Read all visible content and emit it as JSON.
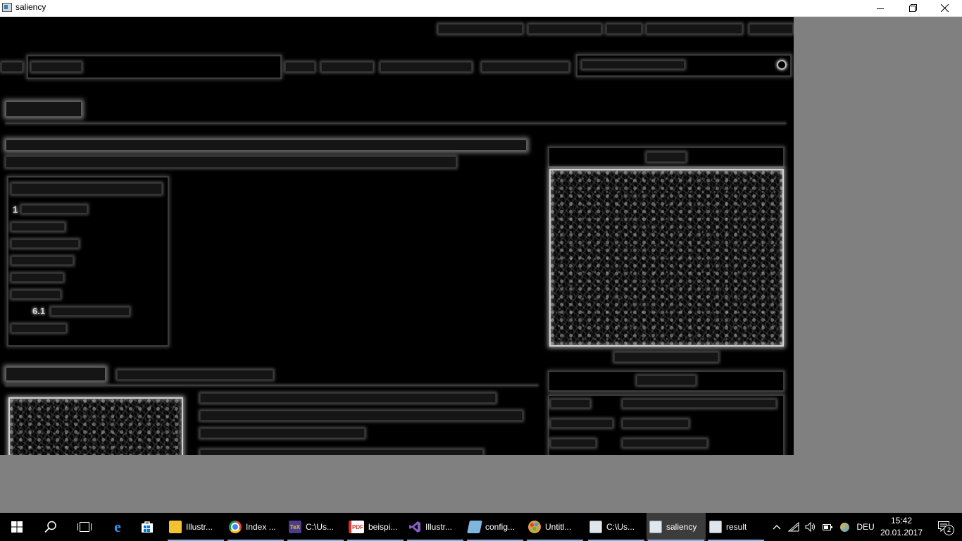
{
  "window": {
    "title": "saliency",
    "controls": {
      "minimize": "minimize-icon",
      "maximize": "restore-icon",
      "close": "close-icon"
    }
  },
  "content": {
    "description_type": "saliency-map",
    "background": "#000000",
    "outer_background": "#808080",
    "toc_numbers": [
      "1",
      "6.1"
    ]
  },
  "taskbar": {
    "start": "windows-start-icon",
    "search": "search-icon",
    "task_view": "task-view-icon",
    "pinned": [
      "edge-icon",
      "store-icon"
    ],
    "tasks": [
      {
        "label": "Illustr...",
        "icon": "folder-icon",
        "color": "#f2c230"
      },
      {
        "label": "Index ...",
        "icon": "chrome-icon",
        "color": "#db4437"
      },
      {
        "label": "C:\\Us...",
        "icon": "texstudio-icon",
        "color": "#4b3c8c"
      },
      {
        "label": "beispi...",
        "icon": "pdf-icon",
        "color": "#d9302c"
      },
      {
        "label": "Illustr...",
        "icon": "visual-studio-icon",
        "color": "#865fc5"
      },
      {
        "label": "config...",
        "icon": "notepad-icon",
        "color": "#7fb6e0"
      },
      {
        "label": "Untitl...",
        "icon": "paint-icon",
        "color": "#d4a04a"
      },
      {
        "label": "C:\\Us...",
        "icon": "app-window-icon",
        "color": "#8ca0b0"
      },
      {
        "label": "saliency",
        "icon": "app-window-icon",
        "color": "#8ca0b0"
      },
      {
        "label": "result",
        "icon": "app-window-icon",
        "color": "#8ca0b0"
      }
    ],
    "tray": {
      "language": "DEU",
      "time": "15:42",
      "date": "20.01.2017",
      "notifications": "2"
    }
  }
}
